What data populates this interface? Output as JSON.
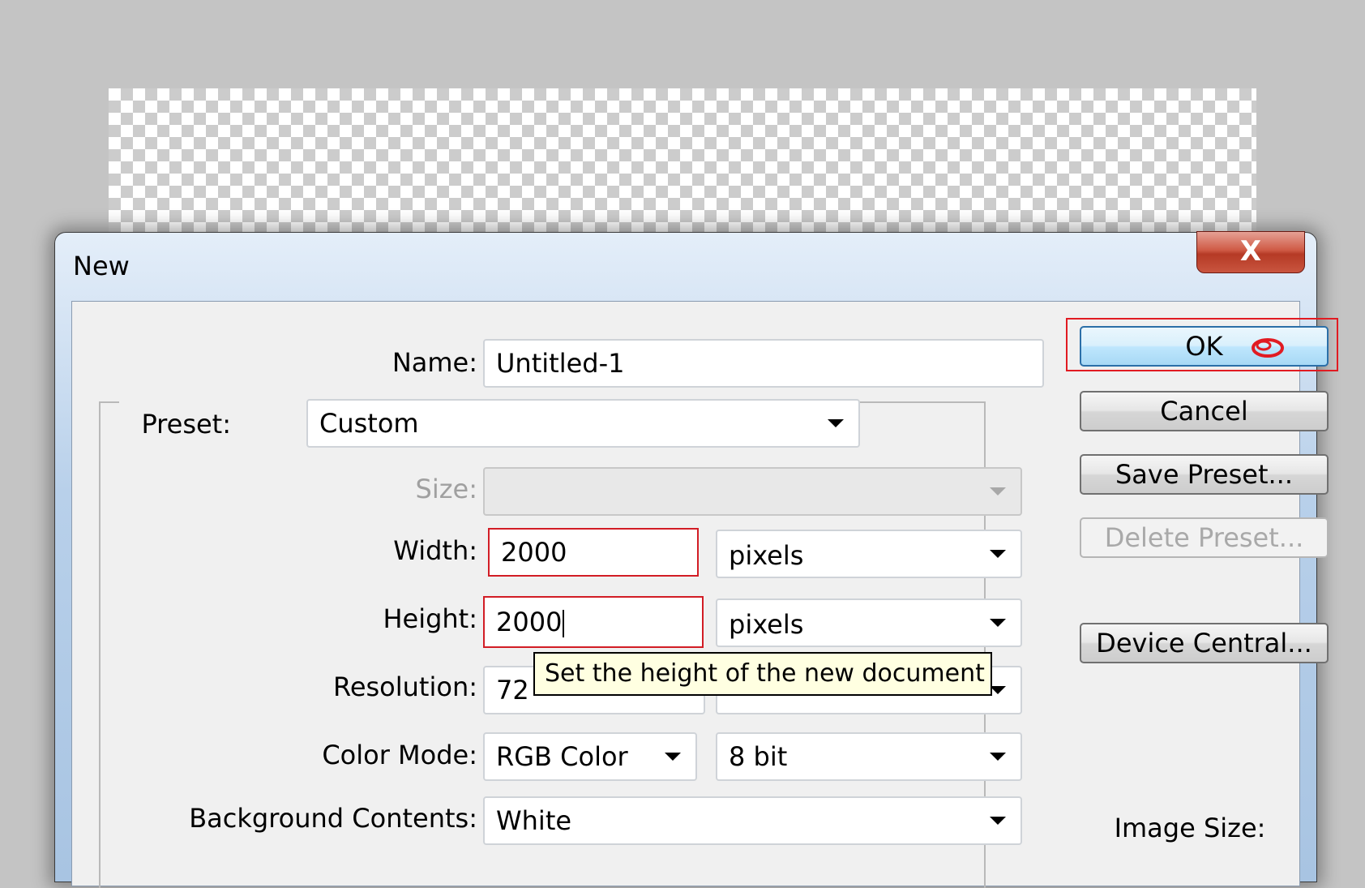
{
  "dialog": {
    "title": "New",
    "close_glyph": "X"
  },
  "fields": {
    "name_label": "Name:",
    "name_value": "Untitled-1",
    "preset_label": "Preset:",
    "preset_value": "Custom",
    "size_label": "Size:",
    "size_value": "",
    "width_label": "Width:",
    "width_value": "2000",
    "width_unit": "pixels",
    "height_label": "Height:",
    "height_value": "2000",
    "height_unit": "pixels",
    "resolution_label": "Resolution:",
    "resolution_value": "72",
    "colormode_label": "Color Mode:",
    "colormode_value": "RGB Color",
    "colormode_depth": "8 bit",
    "background_label": "Background Contents:",
    "background_value": "White"
  },
  "buttons": {
    "ok": "OK",
    "cancel": "Cancel",
    "save_preset": "Save Preset...",
    "delete_preset": "Delete Preset...",
    "device_central": "Device Central..."
  },
  "tooltip": "Set the height of the new document",
  "image_size_label": "Image Size:",
  "colors": {
    "annotation_red": "#e11b22",
    "titlebar_blue": "#b8d0ea",
    "close_red": "#c9553f",
    "tooltip_bg": "#ffffe1"
  },
  "icons": {
    "close": "close-icon",
    "dropdown": "chevron-down-icon"
  }
}
